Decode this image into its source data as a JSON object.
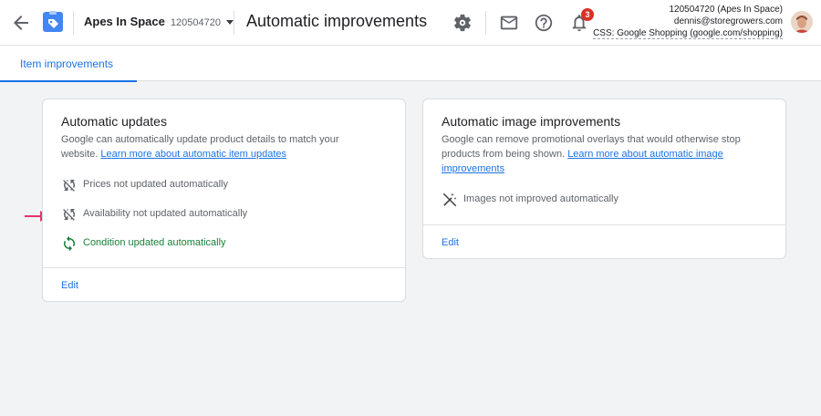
{
  "header": {
    "account_name": "Apes In Space",
    "account_id": "120504720",
    "page_title": "Automatic improvements",
    "notifications_count": "3",
    "user": {
      "line1": "120504720 (Apes In Space)",
      "line2": "dennis@storegrowers.com",
      "line3": "CSS: Google Shopping (google.com/shopping)"
    }
  },
  "tabs": [
    {
      "label": "Item improvements"
    }
  ],
  "cards": {
    "updates": {
      "title": "Automatic updates",
      "desc_text": "Google can automatically update product details to match your website. ",
      "desc_link": "Learn more about automatic item updates",
      "items": [
        {
          "label": "Prices not updated automatically"
        },
        {
          "label": "Availability not updated automatically"
        },
        {
          "label": "Condition updated automatically"
        }
      ],
      "edit_label": "Edit"
    },
    "images": {
      "title": "Automatic image improvements",
      "desc_text": "Google can remove promotional overlays that would otherwise stop products from being shown. ",
      "desc_link": "Learn more about automatic image improvements",
      "items": [
        {
          "label": "Images not improved automatically"
        }
      ],
      "edit_label": "Edit"
    }
  },
  "colors": {
    "accent": "#1a73e8",
    "success": "#188038",
    "badge": "#d93025",
    "arrow": "#e8336b"
  }
}
